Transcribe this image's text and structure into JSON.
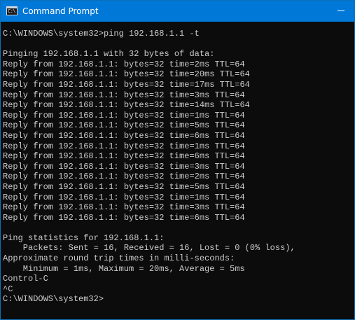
{
  "window": {
    "title": "Command Prompt",
    "icon_name": "cmd-icon",
    "icon_glyph": "C:\\",
    "titlebar_color": "#0078d7",
    "console_bg": "#0c0c0c",
    "console_fg": "#cccccc"
  },
  "console": {
    "lines": [
      "C:\\WINDOWS\\system32>ping 192.168.1.1 -t",
      "",
      "Pinging 192.168.1.1 with 32 bytes of data:",
      "Reply from 192.168.1.1: bytes=32 time=2ms TTL=64",
      "Reply from 192.168.1.1: bytes=32 time=20ms TTL=64",
      "Reply from 192.168.1.1: bytes=32 time=17ms TTL=64",
      "Reply from 192.168.1.1: bytes=32 time=3ms TTL=64",
      "Reply from 192.168.1.1: bytes=32 time=14ms TTL=64",
      "Reply from 192.168.1.1: bytes=32 time=1ms TTL=64",
      "Reply from 192.168.1.1: bytes=32 time=5ms TTL=64",
      "Reply from 192.168.1.1: bytes=32 time=6ms TTL=64",
      "Reply from 192.168.1.1: bytes=32 time=1ms TTL=64",
      "Reply from 192.168.1.1: bytes=32 time=6ms TTL=64",
      "Reply from 192.168.1.1: bytes=32 time=3ms TTL=64",
      "Reply from 192.168.1.1: bytes=32 time=2ms TTL=64",
      "Reply from 192.168.1.1: bytes=32 time=5ms TTL=64",
      "Reply from 192.168.1.1: bytes=32 time=1ms TTL=64",
      "Reply from 192.168.1.1: bytes=32 time=3ms TTL=64",
      "Reply from 192.168.1.1: bytes=32 time=6ms TTL=64",
      "",
      "Ping statistics for 192.168.1.1:",
      "    Packets: Sent = 16, Received = 16, Lost = 0 (0% loss),",
      "Approximate round trip times in milli-seconds:",
      "    Minimum = 1ms, Maximum = 20ms, Average = 5ms",
      "Control-C",
      "^C",
      "C:\\WINDOWS\\system32>"
    ]
  }
}
